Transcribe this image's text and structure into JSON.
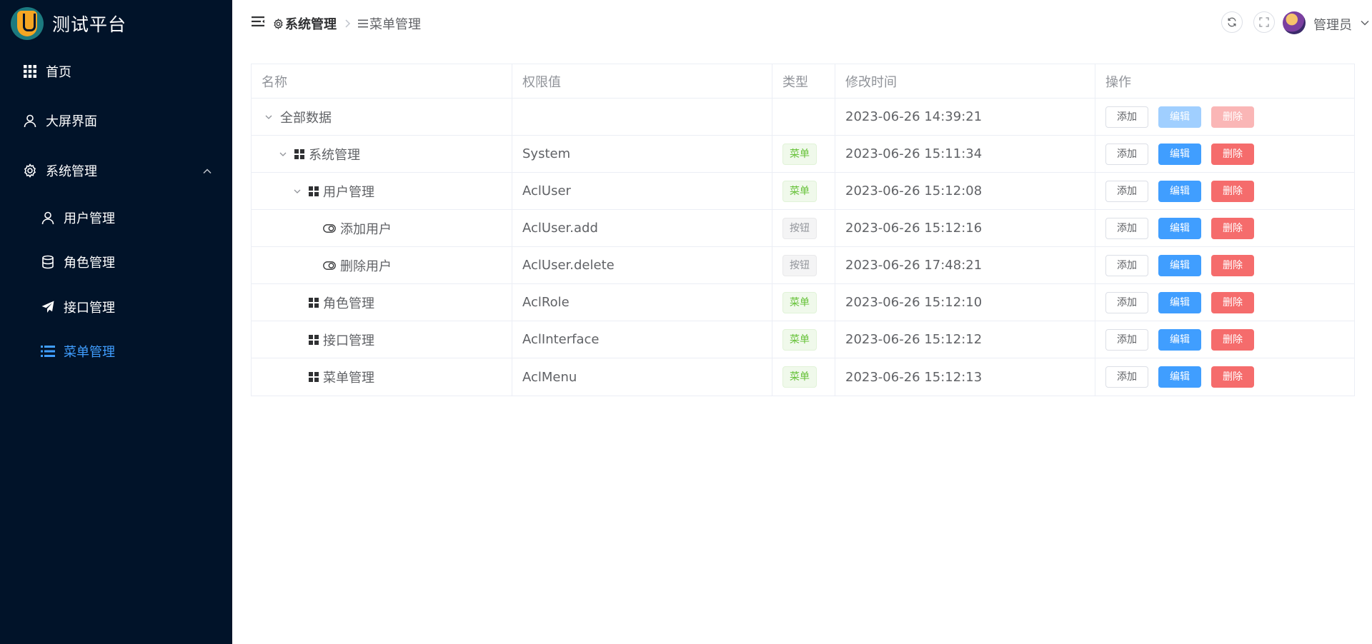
{
  "app": {
    "title": "测试平台"
  },
  "sidebar": {
    "items": [
      {
        "label": "首页",
        "icon": "grid-icon"
      },
      {
        "label": "大屏界面",
        "icon": "user-icon"
      },
      {
        "label": "系统管理",
        "icon": "gear-icon",
        "expanded": true
      },
      {
        "label": "用户管理",
        "icon": "user-icon"
      },
      {
        "label": "角色管理",
        "icon": "database-icon"
      },
      {
        "label": "接口管理",
        "icon": "send-icon"
      },
      {
        "label": "菜单管理",
        "icon": "menu-icon",
        "active": true
      }
    ]
  },
  "header": {
    "breadcrumb": [
      "系统管理",
      "菜单管理"
    ],
    "user_name": "管理员"
  },
  "table": {
    "columns": [
      "名称",
      "权限值",
      "类型",
      "修改时间",
      "操作"
    ],
    "rows": [
      {
        "name": "全部数据",
        "perm": "",
        "type": "",
        "time": "2023-06-26 14:39:21",
        "ops_disabled": true
      },
      {
        "name": "系统管理",
        "perm": "System",
        "type": "菜单",
        "time": "2023-06-26 15:11:34"
      },
      {
        "name": "用户管理",
        "perm": "AclUser",
        "type": "菜单",
        "time": "2023-06-26 15:12:08"
      },
      {
        "name": "添加用户",
        "perm": "AclUser.add",
        "type": "按钮",
        "time": "2023-06-26 15:12:16"
      },
      {
        "name": "删除用户",
        "perm": "AclUser.delete",
        "type": "按钮",
        "time": "2023-06-26 17:48:21"
      },
      {
        "name": "角色管理",
        "perm": "AclRole",
        "type": "菜单",
        "time": "2023-06-26 15:12:10"
      },
      {
        "name": "接口管理",
        "perm": "AclInterface",
        "type": "菜单",
        "time": "2023-06-26 15:12:12"
      },
      {
        "name": "菜单管理",
        "perm": "AclMenu",
        "type": "菜单",
        "time": "2023-06-26 15:12:13"
      }
    ],
    "ops": {
      "add": "添加",
      "edit": "编辑",
      "delete": "删除"
    }
  },
  "colors": {
    "sidebar_bg": "#011329",
    "active": "#409eff",
    "danger": "#f56c6c",
    "success": "#67c23a"
  }
}
